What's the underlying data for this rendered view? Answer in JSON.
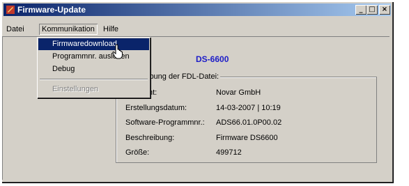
{
  "window": {
    "title": "Firmware-Update",
    "controls": {
      "minimize": "_",
      "maximize": "□",
      "close": "×"
    }
  },
  "menubar": {
    "items": [
      "Datei",
      "Kommunikation",
      "Hilfe"
    ]
  },
  "dropdown": {
    "items": [
      {
        "label": "Firmwaredownload",
        "highlighted": true,
        "enabled": true
      },
      {
        "label": "Programmnr. auslösen",
        "highlighted": false,
        "enabled": true
      },
      {
        "label": "Debug",
        "highlighted": false,
        "enabled": true
      },
      {
        "label": "Einstellungen",
        "highlighted": false,
        "enabled": false
      }
    ]
  },
  "device": {
    "label_partial": ":",
    "value": "DS-6600"
  },
  "fdl": {
    "group_title_partial": "ibung der FDL-Datei:",
    "rows": [
      {
        "label": "ht:",
        "value": "Novar GmbH"
      },
      {
        "label": "Erstellungsdatum:",
        "value": "14-03-2007 | 10:19"
      },
      {
        "label": "Software-Programmnr.:",
        "value": "ADS66.01.0P00.02"
      },
      {
        "label": "Beschreibung:",
        "value": "Firmware DS6600"
      },
      {
        "label": "Größe:",
        "value": "499712"
      }
    ]
  },
  "colors": {
    "titlebar_start": "#0a246a",
    "titlebar_end": "#a6caf0",
    "device_value": "#1c1cc8",
    "highlight": "#0a246a"
  }
}
